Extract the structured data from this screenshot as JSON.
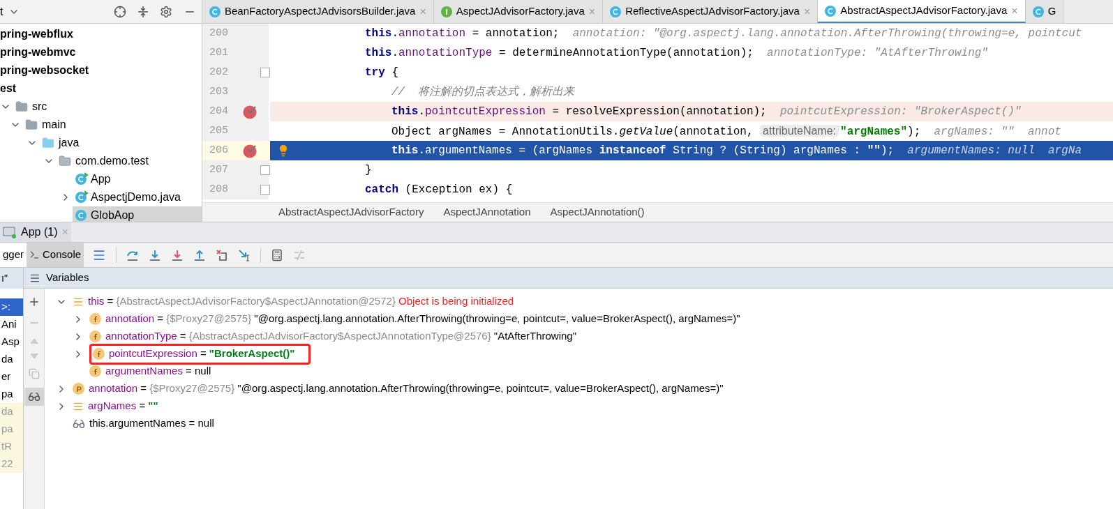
{
  "project_panel": {
    "title": "t",
    "tree": [
      {
        "label": "pring-webflux",
        "kind": "module"
      },
      {
        "label": "pring-webmvc",
        "kind": "module"
      },
      {
        "label": "pring-websocket",
        "kind": "module"
      },
      {
        "label": "est",
        "kind": "module"
      },
      {
        "label": "src",
        "kind": "folder",
        "expanded": true,
        "children": [
          {
            "label": "main",
            "kind": "folder",
            "expanded": true,
            "children": [
              {
                "label": "java",
                "kind": "source",
                "expanded": true,
                "children": [
                  {
                    "label": "com.demo.test",
                    "kind": "package",
                    "expanded": true,
                    "children": [
                      {
                        "label": "App",
                        "kind": "runnable",
                        "selected": false
                      },
                      {
                        "label": "AspectjDemo.java",
                        "kind": "runnable",
                        "expanded": false,
                        "selected": false
                      },
                      {
                        "label": "GlobAop",
                        "kind": "class",
                        "selected": true
                      }
                    ]
                  }
                ]
              }
            ]
          }
        ]
      }
    ]
  },
  "editor_tabs": [
    {
      "label": "BeanFactoryAspectJAdvisorsBuilder.java",
      "kind": "class",
      "selected": false,
      "close": "×"
    },
    {
      "label": "AspectJAdvisorFactory.java",
      "kind": "interface",
      "selected": false,
      "close": "×"
    },
    {
      "label": "ReflectiveAspectJAdvisorFactory.java",
      "kind": "class",
      "selected": false,
      "close": "×"
    },
    {
      "label": "AbstractAspectJAdvisorFactory.java",
      "kind": "class",
      "selected": true,
      "close": "×"
    },
    {
      "label": "G",
      "kind": "class",
      "selected": false
    }
  ],
  "code_lines": [
    {
      "number": "200",
      "breakpoint": false,
      "current": false,
      "fold": false,
      "bulb": false,
      "tokens": [
        {
          "text": "this",
          "kind": "kw"
        },
        {
          "text": ".",
          "kind": "plain"
        },
        {
          "text": "annotation",
          "kind": "field"
        },
        {
          "text": " = annotation;  ",
          "kind": "plain"
        },
        {
          "text": "annotation: \"@org.aspectj.lang.annotation.AfterThrowing(throwing=e, pointcut",
          "kind": "hint"
        }
      ]
    },
    {
      "number": "201",
      "breakpoint": false,
      "current": false,
      "fold": false,
      "bulb": false,
      "tokens": [
        {
          "text": "this",
          "kind": "kw"
        },
        {
          "text": ".",
          "kind": "plain"
        },
        {
          "text": "annotationType",
          "kind": "field"
        },
        {
          "text": " = determineAnnotationType(annotation);  ",
          "kind": "plain"
        },
        {
          "text": "annotationType: \"AtAfterThrowing\"",
          "kind": "hint"
        }
      ]
    },
    {
      "number": "202",
      "breakpoint": false,
      "current": false,
      "fold": true,
      "bulb": false,
      "tokens": [
        {
          "text": "try",
          "kind": "kw"
        },
        {
          "text": " {",
          "kind": "plain"
        }
      ],
      "children": [
        {
          "number": "203",
          "breakpoint": false,
          "current": false,
          "fold": false,
          "bulb": false,
          "tokens": [
            {
              "text": "//  将注解的切点表达式，解析出来",
              "kind": "comment"
            }
          ]
        },
        {
          "number": "204",
          "breakpoint": true,
          "current": false,
          "fold": false,
          "bulb": false,
          "tokens": [
            {
              "text": "this",
              "kind": "kw"
            },
            {
              "text": ".",
              "kind": "plain"
            },
            {
              "text": "pointcutExpression",
              "kind": "field"
            },
            {
              "text": " = resolveExpression(annotation);  ",
              "kind": "plain"
            },
            {
              "text": "pointcutExpression: \"BrokerAspect()\"",
              "kind": "hint"
            }
          ]
        },
        {
          "number": "205",
          "breakpoint": false,
          "current": false,
          "fold": false,
          "bulb": false,
          "tokens": [
            {
              "text": "Object argNames = AnnotationUtils.",
              "kind": "plain"
            },
            {
              "text": "getValue",
              "kind": "italic"
            },
            {
              "text": "(annotation, ",
              "kind": "plain"
            },
            {
              "text": "attributeName:",
              "kind": "param"
            },
            {
              "text": "\"argNames\"",
              "kind": "str"
            },
            {
              "text": ");  ",
              "kind": "plain"
            },
            {
              "text": "argNames: \"\"  annot",
              "kind": "hint"
            }
          ]
        },
        {
          "number": "206",
          "breakpoint": true,
          "current": true,
          "fold": false,
          "bulb": true,
          "tokens": [
            {
              "text": "this",
              "kind": "kw"
            },
            {
              "text": ".",
              "kind": "plain"
            },
            {
              "text": "argumentNames",
              "kind": "field"
            },
            {
              "text": " = (argNames ",
              "kind": "plain"
            },
            {
              "text": "instanceof",
              "kind": "kw"
            },
            {
              "text": " String ? (String) argNames : ",
              "kind": "plain"
            },
            {
              "text": "\"\"",
              "kind": "str"
            },
            {
              "text": ");  ",
              "kind": "plain"
            },
            {
              "text": "argumentNames: null  argNa",
              "kind": "hint"
            }
          ]
        }
      ]
    },
    {
      "number": "207",
      "breakpoint": false,
      "current": false,
      "fold": true,
      "bulb": false,
      "tokens": [
        {
          "text": "}",
          "kind": "plain"
        }
      ]
    },
    {
      "number": "208",
      "breakpoint": false,
      "current": false,
      "fold": true,
      "bulb": false,
      "tokens": [
        {
          "text": "catch",
          "kind": "kw"
        },
        {
          "text": " (Exception ex) {",
          "kind": "plain"
        }
      ]
    }
  ],
  "breadcrumbs": [
    "AbstractAspectJAdvisorFactory",
    "AspectJAnnotation",
    "AspectJAnnotation()"
  ],
  "debug": {
    "session_tab": {
      "label": "App (1)",
      "close": "×"
    },
    "tabs": [
      {
        "label": "gger",
        "selected": true
      },
      {
        "label": "Console",
        "selected": false
      }
    ],
    "frames_header": "ı\"",
    "frames": [
      {
        "text": ">:",
        "selected": true
      },
      {
        "text": "Ani",
        "selected": false
      },
      {
        "text": "Asp",
        "selected": false
      },
      {
        "text": "da",
        "selected": false
      },
      {
        "text": "er",
        "selected": false
      },
      {
        "text": "pa",
        "selected": false
      },
      {
        "text": "da",
        "selected": false
      },
      {
        "text": "pa",
        "selected": false
      },
      {
        "text": "tR",
        "selected": false
      },
      {
        "text": "22",
        "selected": false
      }
    ],
    "variables_title": "Variables",
    "variables": [
      {
        "kind": "object",
        "name": "this",
        "operator": "=",
        "type": "{AbstractAspectJAdvisorFactory$AspectJAnnotation@2572}",
        "error": "Object is being initialized",
        "expanded": true,
        "outlined": false,
        "children": [
          {
            "kind": "field",
            "name": "annotation",
            "operator": "=",
            "type": "{$Proxy27@2575}",
            "value": "\"@org.aspectj.lang.annotation.AfterThrowing(throwing=e, pointcut=, value=BrokerAspect(), argNames=)\"",
            "string_value": false,
            "expanded": false,
            "outlined": false
          },
          {
            "kind": "field",
            "name": "annotationType",
            "operator": "=",
            "type": "{AbstractAspectJAdvisorFactory$AspectJAnnotationType@2576}",
            "value": "\"AtAfterThrowing\"",
            "string_value": false,
            "expanded": false,
            "outlined": false
          },
          {
            "kind": "field",
            "name": "pointcutExpression",
            "operator": "=",
            "value": "\"BrokerAspect()\"",
            "string_value": true,
            "expanded": false,
            "outlined": true
          },
          {
            "kind": "field",
            "name": "argumentNames",
            "operator": "=",
            "value": "null",
            "string_value": false,
            "outlined": false
          }
        ]
      },
      {
        "kind": "param",
        "name": "annotation",
        "operator": "=",
        "type": "{$Proxy27@2575}",
        "value": "\"@org.aspectj.lang.annotation.AfterThrowing(throwing=e, pointcut=, value=BrokerAspect(), argNames=)\"",
        "string_value": false,
        "expanded": false,
        "outlined": false
      },
      {
        "kind": "object",
        "name": "argNames",
        "operator": "=",
        "value": "\"\"",
        "string_value": true,
        "expanded": false,
        "outlined": false
      },
      {
        "kind": "watch",
        "name": "this.argumentNames",
        "operator": "=",
        "value": "null",
        "string_value": false,
        "outlined": false
      }
    ]
  }
}
